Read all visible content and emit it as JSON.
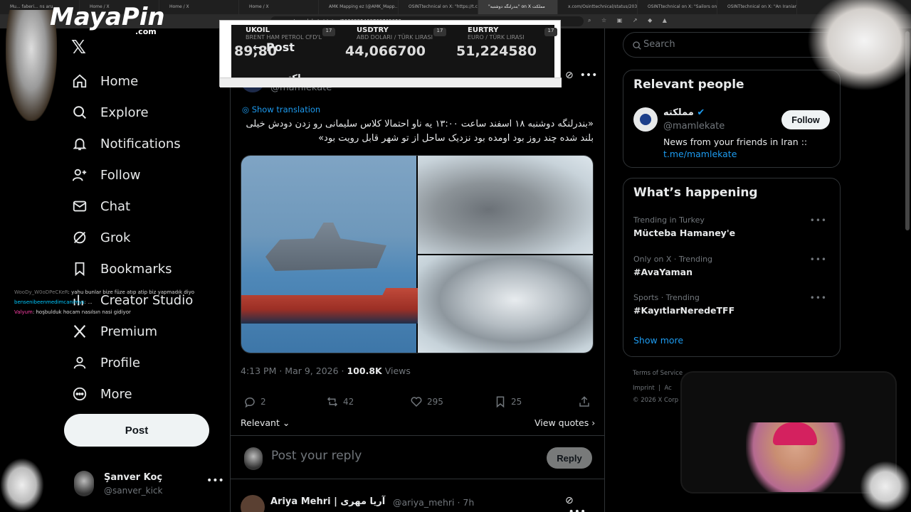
{
  "browser": {
    "tabs": [
      {
        "label": "Mu... faberi... ns aru"
      },
      {
        "label": "Home / X"
      },
      {
        "label": "Home / X"
      },
      {
        "label": "Home / X"
      },
      {
        "label": "AMK Mapping ez (@AMK_Mapp..."
      },
      {
        "label": "OSINTtechnical on X: \"https://t.co..."
      },
      {
        "label": "\"بندرلنگه دوشنبه\" on X مملکت"
      },
      {
        "label": "x.com/Osinttechnical/status/2031..."
      },
      {
        "label": "OSINTtechnical on X: \"Sailors onb..."
      },
      {
        "label": "OSINTtechnical on X: \"An Iranian..."
      }
    ],
    "url": "x.com/mamlekate/status/2030995468763705853"
  },
  "overlay": {
    "logo": "MayaPin",
    "logo_sub": ".com"
  },
  "ticker": {
    "items": [
      {
        "name": "UKOIL",
        "sub": "BRENT HAM PETROL CFD'L",
        "value": "89,80"
      },
      {
        "name": "USDTRY",
        "sub": "ABD DOLARI / TÜRK LIRASI",
        "value": "44,066700"
      },
      {
        "name": "EURTRY",
        "sub": "EURO / TÜRK LIRASI",
        "value": "51,224580"
      }
    ]
  },
  "nav": {
    "items": [
      {
        "label": "Home",
        "icon": "home-icon"
      },
      {
        "label": "Explore",
        "icon": "search-icon"
      },
      {
        "label": "Notifications",
        "icon": "bell-icon"
      },
      {
        "label": "Follow",
        "icon": "follow-icon"
      },
      {
        "label": "Chat",
        "icon": "mail-icon"
      },
      {
        "label": "Grok",
        "icon": "grok-icon"
      },
      {
        "label": "Bookmarks",
        "icon": "bookmark-icon"
      },
      {
        "label": "Creator Studio",
        "icon": "studio-icon"
      },
      {
        "label": "Premium",
        "icon": "x-icon"
      },
      {
        "label": "Profile",
        "icon": "user-icon"
      },
      {
        "label": "More",
        "icon": "more-icon"
      }
    ],
    "post_label": "Post"
  },
  "account": {
    "name": "Şanver Koç",
    "handle": "@sanver_kick"
  },
  "chat": [
    {
      "user": "WooDy_W0oDPeCKeR",
      "message": ": yahu bunlar bize füze atıp atip biz yapmadık diyo"
    },
    {
      "user": "bensenibeenmedimcanimys",
      "message": ": ... "
    },
    {
      "user": "Valyum",
      "message": ": hoşbulduk hocam nasılsın nasi gidiyor"
    }
  ],
  "post": {
    "header": "Post",
    "author_name": "مملکته",
    "author_handle": "@mamlekate",
    "show_translation": "Show translation",
    "text": "«بندرلنگه دوشنبه ۱۸ اسفند ساعت ۱۳:۰۰ یه ناو احتمالا کلاس سلیمانی رو زدن دودش خیلی بلند شده چند روز بود اومده بود نزدیک ساحل از تو شهر قابل رویت بود»",
    "time": "4:13 PM · Mar 9, 2026 · ",
    "views_count": "100.8K",
    "views_label": " Views",
    "replies": "2",
    "reposts": "42",
    "likes": "295",
    "bookmarks": "25",
    "relevant_label": "Relevant",
    "view_quotes": "View quotes",
    "reply_placeholder": "Post your reply",
    "reply_button": "Reply"
  },
  "next_reply": {
    "name": "Ariya Mehri | آریا مهری",
    "handle": "@ariya_mehri · 7h"
  },
  "right": {
    "search_placeholder": "Search",
    "relevant_title": "Relevant people",
    "person": {
      "name": "مملکته",
      "handle": "@mamlekate",
      "bio": "News from your friends in Iran ::",
      "link": "t.me/mamlekate",
      "follow": "Follow"
    },
    "happening_title": "What’s happening",
    "trends": [
      {
        "context": "Trending in Turkey",
        "name": "Mücteba Hamaney'e"
      },
      {
        "context": "Only on X · Trending",
        "name": "#AvaYaman"
      },
      {
        "context": "Sports · Trending",
        "name": "#KayıtlarNeredeTFF"
      }
    ],
    "show_more": "Show more",
    "footer": {
      "terms": "Terms of Service",
      "imprint": "Imprint",
      "imprint_tail": "Ac",
      "copyright": "© 2026 X Corp"
    }
  },
  "colors": {
    "accent": "#1d9bf0",
    "background": "#000000",
    "text": "#e7e9ea",
    "muted": "#71767b"
  }
}
